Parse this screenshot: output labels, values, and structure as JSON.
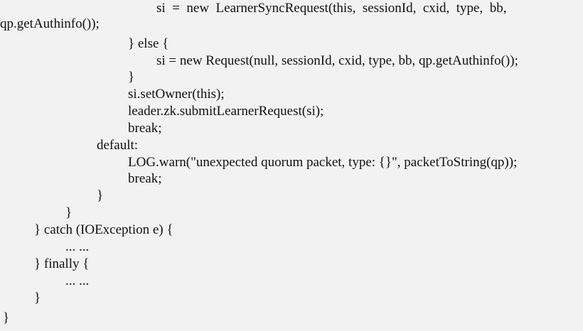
{
  "code_lines": [
    "si  =  new  LearnerSyncRequest(this,  sessionId,  cxid,  type,  bb,",
    "qp.getAuthinfo());",
    "} else {",
    "si = new Request(null, sessionId, cxid, type, bb, qp.getAuthinfo());",
    "}",
    "si.setOwner(this);",
    "leader.zk.submitLearnerRequest(si);",
    "break;",
    "default:",
    "LOG.warn(\"unexpected quorum packet, type: {}\", packetToString(qp));",
    "break;",
    "}",
    "}",
    "} catch (IOException e) {",
    "... ...",
    "} finally {",
    "... ...",
    "}",
    "}"
  ]
}
